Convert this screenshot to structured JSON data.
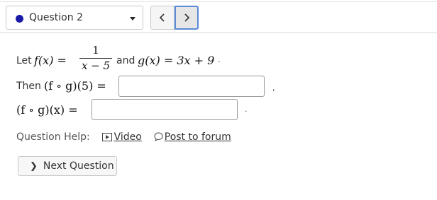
{
  "header": {
    "question_select": {
      "selected": "Question 2",
      "status_color": "#1a1aa6"
    },
    "prev_icon": "chevron-left-icon",
    "next_icon": "chevron-right-icon"
  },
  "problem": {
    "let": "Let",
    "f_lhs": "f(x) =",
    "frac_num": "1",
    "frac_den": "x − 5",
    "and": "and",
    "g_def": "g(x) = 3x + 9",
    "g_trail": ".",
    "then": "Then",
    "comp_eval": "(f ∘ g)(5) =",
    "answer1": "",
    "answer1_trail": ",",
    "comp_general": "(f ∘ g)(x) =",
    "answer2": "",
    "answer2_trail": "."
  },
  "help": {
    "label": "Question Help:",
    "video_label": "Video",
    "forum_label": "Post to forum"
  },
  "next_question": {
    "label": "Next Question"
  }
}
